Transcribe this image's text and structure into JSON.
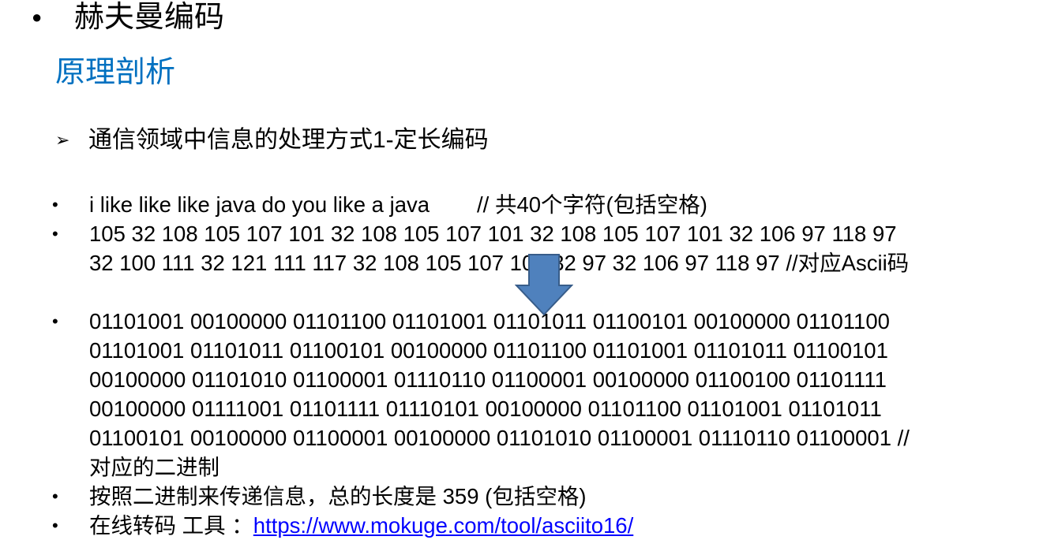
{
  "slide": {
    "title_bullet": "●",
    "title": "赫夫曼编码",
    "section_title": "原理剖析",
    "subheading_marker": "➢",
    "subheading": "通信领域中信息的处理方式1-定长编码"
  },
  "bullets": {
    "marker": "•",
    "text_line": "i like like like java do you like a java",
    "text_comment": "// 共40个字符(包括空格)",
    "ascii_line1": "105 32 108 105 107 101 32 108 105 107 101 32 108 105 107 101 32 106 97 118 97",
    "ascii_line2": "32 100 111 32 121 111 117 32 108 105 107 101 32 97 32 106 97 118 97  //对应Ascii码",
    "binary_line1": "01101001 00100000 01101100 01101001 01101011 01100101 00100000 01101100",
    "binary_line2": "01101001 01101011 01100101 00100000 01101100 01101001 01101011 01100101",
    "binary_line3": "00100000 01101010 01100001 01110110 01100001 00100000 01100100 01101111",
    "binary_line4": "00100000 01111001 01101111 01110101 00100000 01101100 01101001 01101011",
    "binary_line5": "01100101 00100000 01100001 00100000 01101010 01100001 01110110 01100001 //",
    "binary_line6": "对应的二进制",
    "length_text": "按照二进制来传递信息，总的长度是  359   (包括空格)",
    "tool_prefix": "在线转码 工具 ：",
    "tool_link": "https://www.mokuge.com/tool/asciito16/"
  },
  "colors": {
    "section_title": "#0070c0",
    "arrow_fill": "#4f81bd",
    "arrow_stroke": "#385d8a",
    "link": "#0000ff"
  },
  "icons": {
    "down_arrow": "down-arrow-icon"
  }
}
